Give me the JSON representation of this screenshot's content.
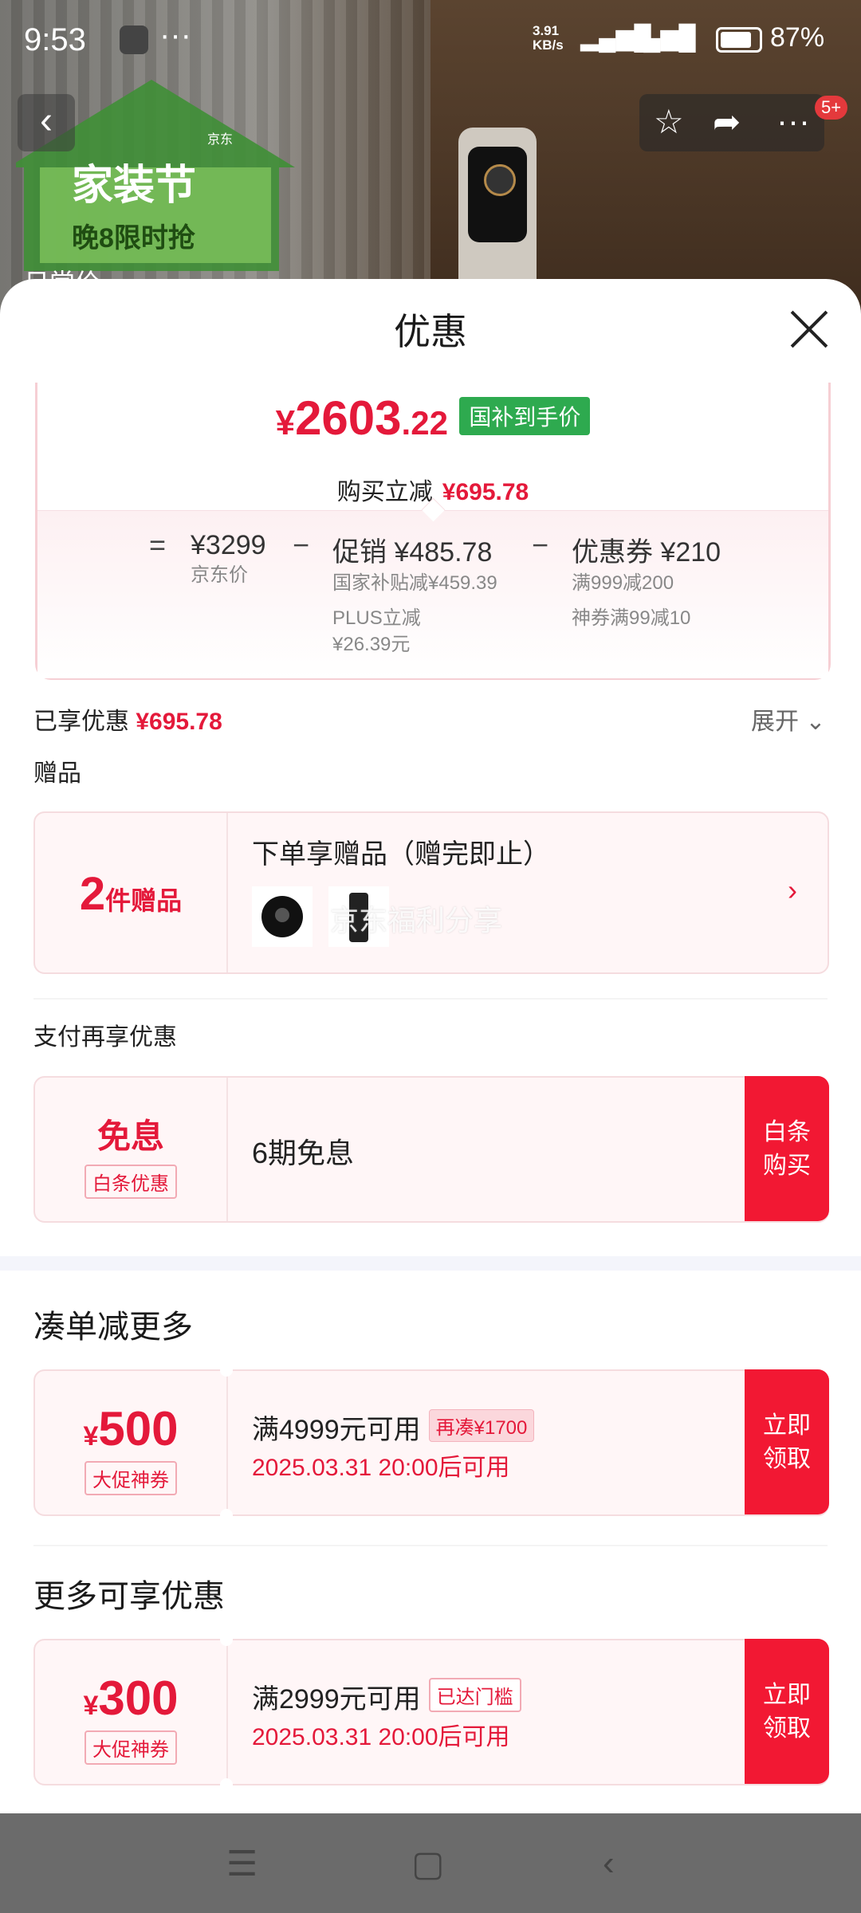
{
  "status_bar": {
    "time": "9:53",
    "dots": "···",
    "net_speed_top": "3.91",
    "net_speed_bottom": "KB/s",
    "battery": "87%"
  },
  "background": {
    "promo_title": "家装节",
    "promo_sub": "晚8限时抢",
    "promo_brand": "京东",
    "partial_text": "日常价",
    "badge": "5+"
  },
  "sheet": {
    "title": "优惠"
  },
  "price_card": {
    "currency": "¥",
    "price_int": "2603",
    "price_dec": ".22",
    "tag": "国补到手价",
    "reduce_label": "购买立减",
    "reduce_value": "¥695.78",
    "eq": "=",
    "minus": "−",
    "jd_price": "¥3299",
    "jd_price_label": "京东价",
    "promo": "促销 ¥485.78",
    "promo_line1": "国家补贴减¥459.39",
    "promo_line2": "PLUS立减",
    "promo_line3": "¥26.39元",
    "coupon": "优惠券 ¥210",
    "coupon_line1": "满999减200",
    "coupon_line2": "神券满99减10"
  },
  "enjoyed": {
    "label": "已享优惠",
    "value": "¥695.78",
    "expand": "展开"
  },
  "gifts": {
    "section": "赠品",
    "count": "2",
    "count_unit": "件赠品",
    "title": "下单享赠品（赠完即止）",
    "watermark": "京东福利分享"
  },
  "pay": {
    "section": "支付再享优惠",
    "left_title": "免息",
    "left_sub": "白条优惠",
    "text": "6期免息",
    "button": "白条购买"
  },
  "combine": {
    "title": "凑单减更多",
    "currency": "¥",
    "amount": "500",
    "sub": "大促神券",
    "condition": "满4999元可用",
    "tag": "再凑¥1700",
    "date": "2025.03.31 20:00后可用",
    "button": "立即领取"
  },
  "more": {
    "title": "更多可享优惠",
    "currency": "¥",
    "amount": "300",
    "sub": "大促神券",
    "condition": "满2999元可用",
    "tag": "已达门槛",
    "date": "2025.03.31 20:00后可用",
    "button": "立即领取"
  },
  "colors": {
    "accent_red": "#e4193a",
    "button_red": "#f21833",
    "national_green": "#2eaa4f"
  }
}
